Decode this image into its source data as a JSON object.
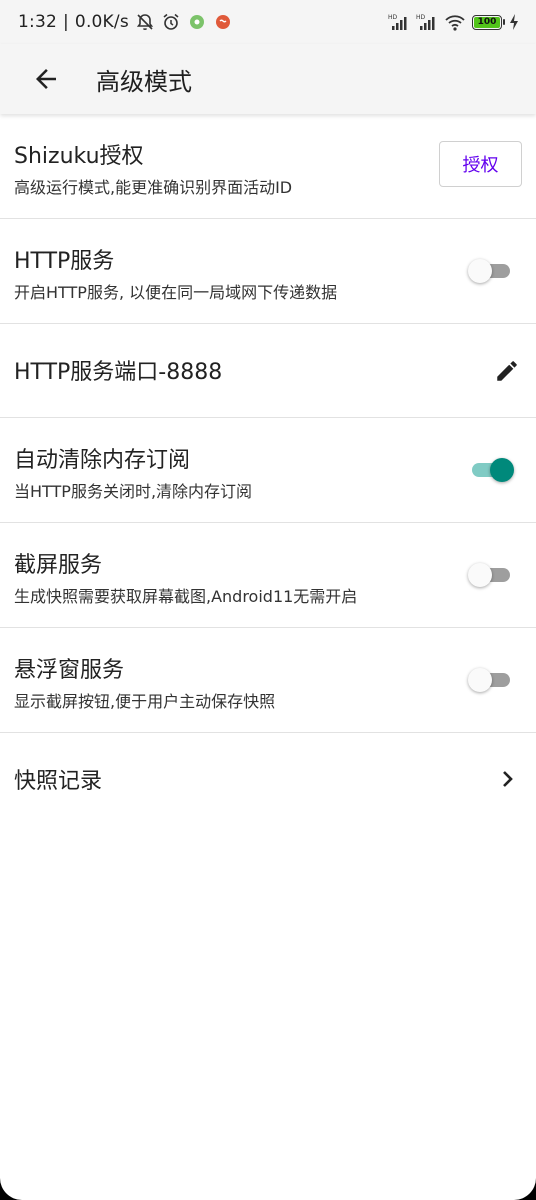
{
  "status_bar": {
    "time": "1:32",
    "network_speed": "0.0K/s",
    "battery_level": "100",
    "icons": [
      "mute-icon",
      "alarm-icon",
      "app-notification-icon",
      "app-notification-icon",
      "signal-hd-icon",
      "signal-hd-icon",
      "wifi-icon",
      "battery-icon",
      "charging-icon"
    ]
  },
  "app_bar": {
    "title": "高级模式",
    "back_icon": "arrow-back-icon"
  },
  "settings": {
    "shizuku": {
      "title": "Shizuku授权",
      "subtitle": "高级运行模式,能更准确识别界面活动ID",
      "button_label": "授权"
    },
    "http_service": {
      "title": "HTTP服务",
      "subtitle": "开启HTTP服务, 以便在同一局域网下传递数据",
      "enabled": false
    },
    "http_port": {
      "title": "HTTP服务端口-8888",
      "icon": "edit-icon"
    },
    "auto_clear": {
      "title": "自动清除内存订阅",
      "subtitle": "当HTTP服务关闭时,清除内存订阅",
      "enabled": true
    },
    "screenshot_service": {
      "title": "截屏服务",
      "subtitle": "生成快照需要获取屏幕截图,Android11无需开启",
      "enabled": false
    },
    "floating_window": {
      "title": "悬浮窗服务",
      "subtitle": "显示截屏按钮,便于用户主动保存快照",
      "enabled": false
    },
    "snapshot_records": {
      "title": "快照记录",
      "icon": "chevron-right-icon"
    }
  },
  "colors": {
    "accent": "#6200ee",
    "switch_on": "#00897b",
    "switch_on_track": "#80cbc4",
    "switch_off_track": "#9e9e9e",
    "battery_fill": "#52c41a"
  }
}
